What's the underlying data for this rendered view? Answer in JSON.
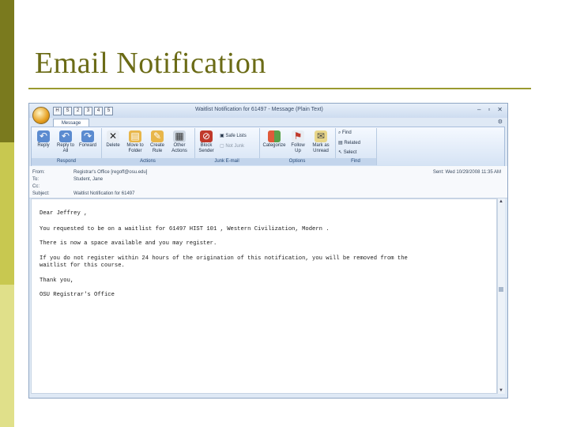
{
  "slide": {
    "title": "Email Notification"
  },
  "window": {
    "title": "Waitlist Notification for 61497 - Message (Plain Text)",
    "qat": [
      "H",
      "S",
      "2",
      "3",
      "4",
      "5"
    ],
    "controls": {
      "minimize": "–",
      "maximize": "▫",
      "close": "✕"
    },
    "tab_message": "Message",
    "tab_hint": "H"
  },
  "ribbon": {
    "respond": {
      "label": "Respond",
      "reply": "Reply",
      "reply_all": "Reply to All",
      "forward": "Forward"
    },
    "actions": {
      "label": "Actions",
      "delete": "Delete",
      "move": "Move to Folder",
      "create_rule": "Create Rule",
      "other": "Other Actions"
    },
    "junk": {
      "label": "Junk E-mail",
      "block": "Block Sender",
      "safe_lists": "Safe Lists",
      "not_junk": "Not Junk"
    },
    "options": {
      "label": "Options",
      "categorize": "Categorize",
      "follow_up": "Follow Up",
      "mark_unread": "Mark as Unread"
    },
    "find": {
      "label": "Find",
      "find_item": "Find",
      "related": "Related",
      "select": "Select"
    }
  },
  "headers": {
    "from_label": "From:",
    "from_value": "Registrar's Office [regoff@osu.edu]",
    "to_label": "To:",
    "to_value": "Student, Jane",
    "cc_label": "Cc:",
    "cc_value": "",
    "subject_label": "Subject:",
    "subject_value": "Waitlist Notification for 61497",
    "sent": "Sent: Wed 10/29/2008 11:35 AM"
  },
  "message": {
    "greeting": "Dear Jeffrey ,",
    "line1": "You requested to be on a waitlist for 61497 HIST 101 , Western Civilization, Modern .",
    "line2": "There is now a space available and you may register.",
    "line3a": "If you do not register within 24 hours of the origination of this notification, you will be removed from the",
    "line3b": "waitlist for this course.",
    "thanks": "Thank you,",
    "signature": "OSU Registrar's Office"
  }
}
